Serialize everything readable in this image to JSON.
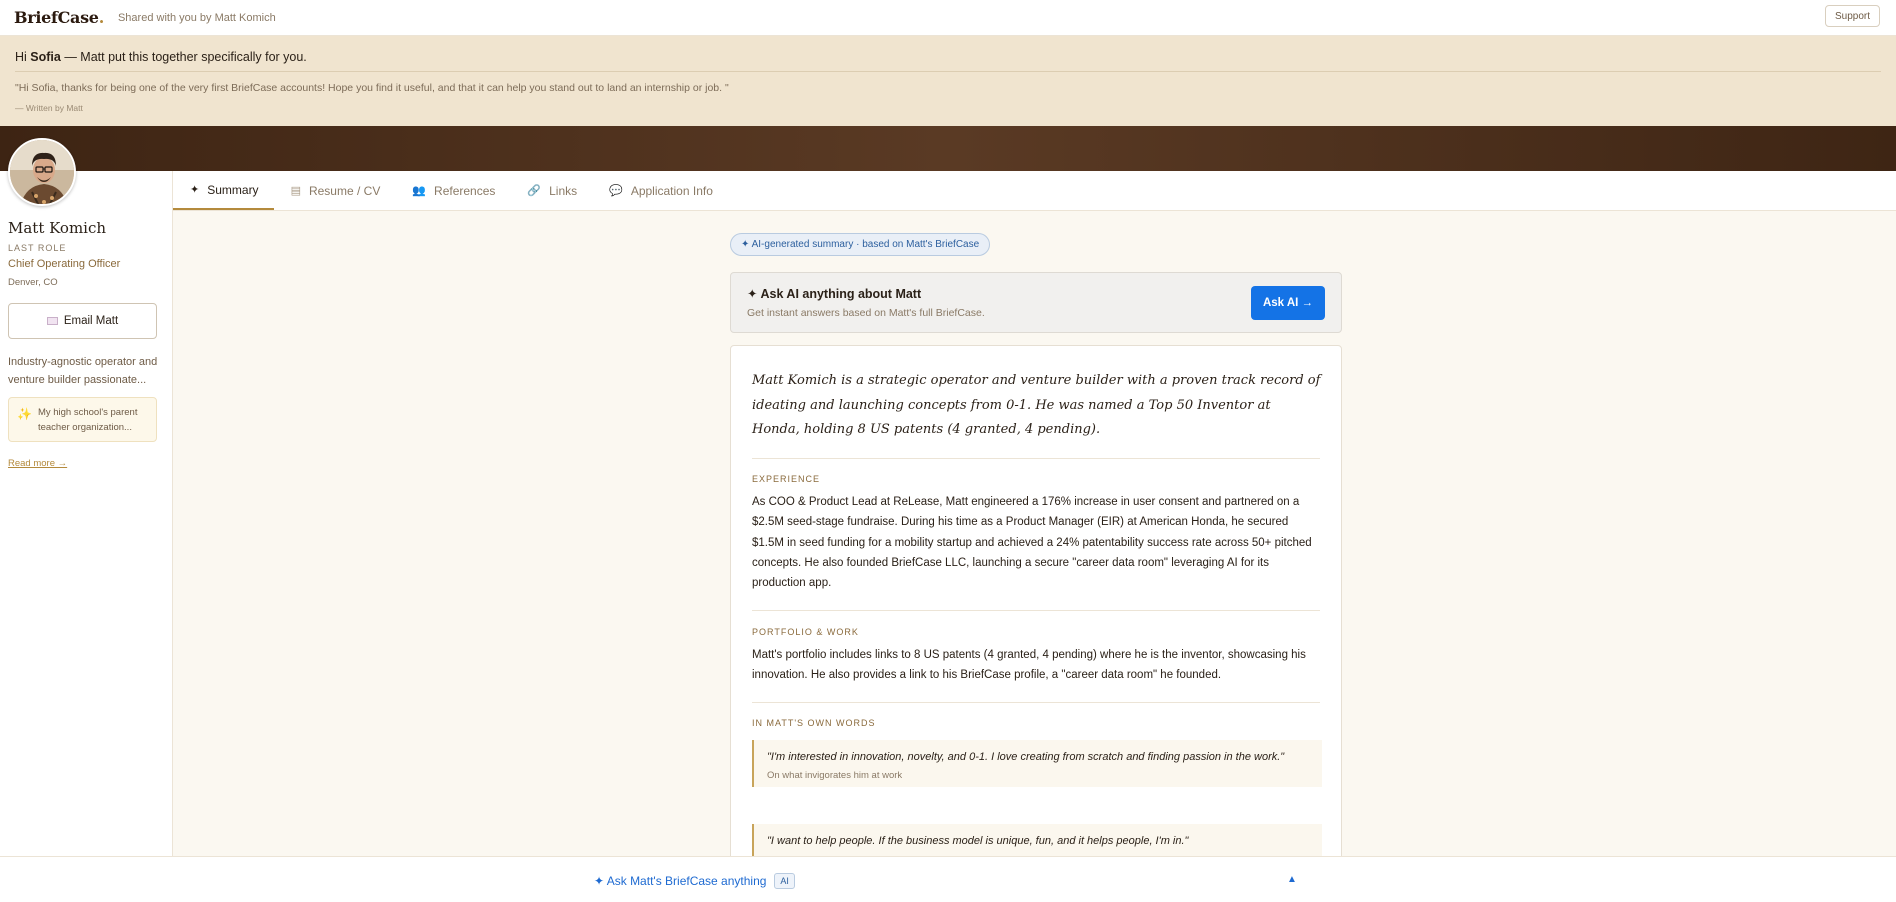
{
  "topbar": {
    "logo": "BriefCase",
    "logo_dot": ".",
    "shared_text": "Shared with you by Matt Komich",
    "support_label": "Support"
  },
  "banner": {
    "greeting_prefix": "Hi ",
    "greeting_name": "Sofia",
    "greeting_suffix": " — Matt put this together specifically for you.",
    "quote": "\"Hi Sofia, thanks for being one of the very first BriefCase accounts! Hope you find it useful, and that it can help you stand out to land an internship or job. \"",
    "written_by": "— Written by Matt"
  },
  "profile": {
    "name": "Matt Komich",
    "last_role_label": "LAST ROLE",
    "role": "Chief Operating Officer",
    "location": "Denver, CO",
    "email_button": "Email Matt",
    "bio": "Industry-agnostic operator and venture builder passionate...",
    "highlight": "My high school's parent teacher organization...",
    "read_more": "Read more →"
  },
  "tabs": [
    {
      "label": "Summary",
      "icon": "sparkle-icon",
      "active": true
    },
    {
      "label": "Resume / CV",
      "icon": "document-icon",
      "active": false
    },
    {
      "label": "References",
      "icon": "people-icon",
      "active": false
    },
    {
      "label": "Links",
      "icon": "link-icon",
      "active": false
    },
    {
      "label": "Application Info",
      "icon": "chat-icon",
      "active": false
    }
  ],
  "main": {
    "ai_pill": "✦ AI-generated summary · based on Matt's BriefCase",
    "ask_card": {
      "title": "✦ Ask AI anything about Matt",
      "subtitle": "Get instant answers based on Matt's full BriefCase.",
      "button": "Ask AI →"
    },
    "intro": "Matt Komich is a strategic operator and venture builder with a proven track record of ideating and launching concepts from 0-1. He was named a Top 50 Inventor at Honda, holding 8 US patents (4 granted, 4 pending).",
    "experience_label": "EXPERIENCE",
    "experience_text": "As COO & Product Lead at ReLease, Matt engineered a 176% increase in user consent and partnered on a $2.5M seed-stage fundraise. During his time as a Product Manager (EIR) at American Honda, he secured $1.5M in seed funding for a mobility startup and achieved a 24% patentability success rate across 50+ pitched concepts. He also founded BriefCase LLC, launching a secure \"career data room\" leveraging AI for its production app.",
    "portfolio_label": "PORTFOLIO & WORK",
    "portfolio_text": "Matt's portfolio includes links to 8 US patents (4 granted, 4 pending) where he is the inventor, showcasing his innovation. He also provides a link to his BriefCase profile, a \"career data room\" he founded.",
    "own_words_label": "IN MATT'S OWN WORDS",
    "quotes": [
      {
        "text": "\"I'm interested in innovation, novelty, and 0-1. I love creating from scratch and finding passion in the work.\"",
        "context": "On what invigorates him at work"
      },
      {
        "text": "\"I want to help people. If the business model is unique, fun, and it helps people, I'm in.\"",
        "context": ""
      }
    ]
  },
  "bottombar": {
    "ask_label": "✦ Ask Matt's BriefCase anything",
    "ai_badge": "AI",
    "chevron": "▲"
  },
  "colors": {
    "accent_blue": "#1473e6",
    "gold": "#b48a3c",
    "banner_bg": "#f0e4cf",
    "brown_strip": "#4a2e1a"
  }
}
